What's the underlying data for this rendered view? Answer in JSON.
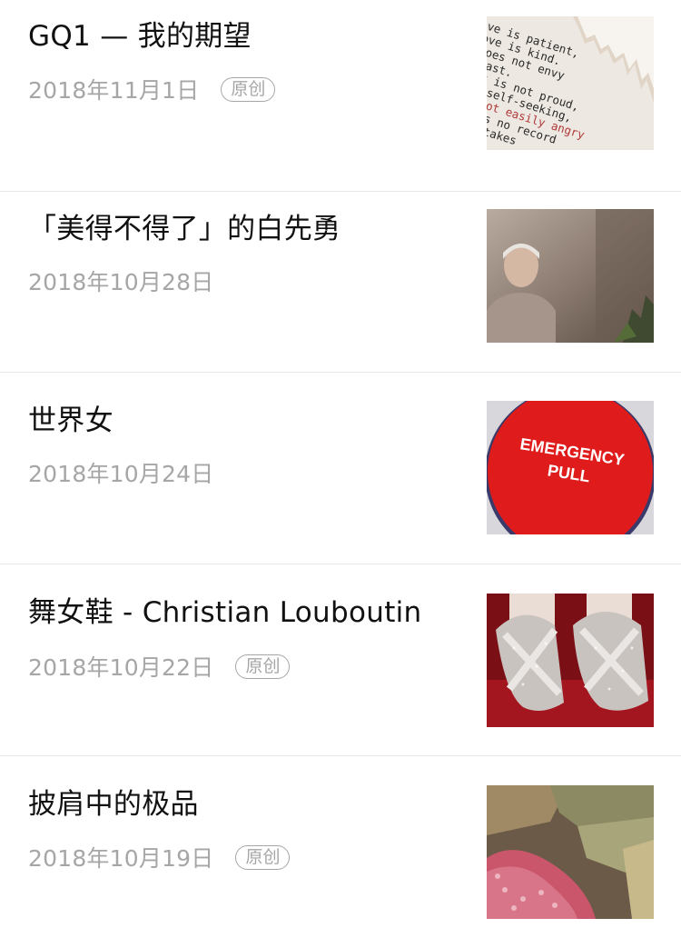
{
  "articles": [
    {
      "title": "GQ1 — 我的期望",
      "date": "2018年11月1日",
      "badge": "原创",
      "thumb_icon": "typewriter-text-image",
      "thumb_text": [
        "ve is patient,",
        "ove is kind.",
        "does not envy",
        "boast.",
        "It is not proud,",
        "or self-seeking,",
        "is not easily angry",
        "keeps no record",
        "t mistakes"
      ]
    },
    {
      "title": "「美得不得了」的白先勇",
      "date": "2018年10月28日",
      "thumb_icon": "portrait-photo-image"
    },
    {
      "title": "世界女",
      "date": "2018年10月24日",
      "thumb_icon": "emergency-button-image",
      "thumb_text": [
        "EMERGENCY",
        "PULL"
      ]
    },
    {
      "title": "舞女鞋 - Christian Louboutin",
      "date": "2018年10月22日",
      "badge": "原创",
      "thumb_icon": "high-heels-photo-image"
    },
    {
      "title": "披肩中的极品",
      "date": "2018年10月19日",
      "badge": "原创",
      "thumb_icon": "shawl-fabric-photo-image"
    }
  ],
  "colors": {
    "title": "#111111",
    "meta": "#a6a6a6",
    "divider": "#e6e6e6",
    "emergency_red": "#e01b1b"
  }
}
